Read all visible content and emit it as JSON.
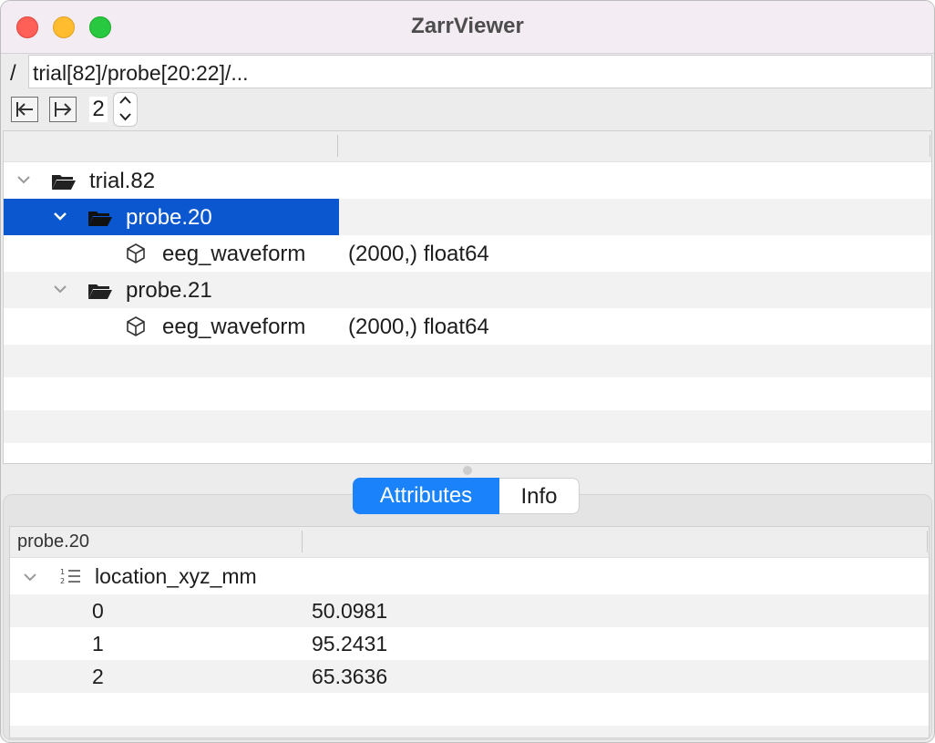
{
  "window": {
    "title": "ZarrViewer"
  },
  "path": {
    "root_sep": "/",
    "value": "trial[82]/probe[20:22]/..."
  },
  "toolbar": {
    "step_value": "2"
  },
  "tree": {
    "rows": [
      {
        "label": "trial.82",
        "info": "",
        "icon": "folder-open-icon",
        "expanded": true,
        "selected": false
      },
      {
        "label": "probe.20",
        "info": "",
        "icon": "folder-open-icon",
        "expanded": true,
        "selected": true
      },
      {
        "label": "eeg_waveform",
        "info": "(2000,) float64",
        "icon": "array-cube-icon"
      },
      {
        "label": "probe.21",
        "info": "",
        "icon": "folder-open-icon",
        "expanded": true,
        "selected": false
      },
      {
        "label": "eeg_waveform",
        "info": "(2000,) float64",
        "icon": "array-cube-icon"
      }
    ]
  },
  "tabs": {
    "attributes": "Attributes",
    "info": "Info",
    "active": "Attributes"
  },
  "attributes": {
    "header": "probe.20",
    "group": {
      "name": "location_xyz_mm",
      "icon": "numbered-list-icon"
    },
    "items": [
      {
        "index": "0",
        "value": "50.0981"
      },
      {
        "index": "1",
        "value": "95.2431"
      },
      {
        "index": "2",
        "value": "65.3636"
      }
    ]
  },
  "colors": {
    "selection": "#0b57d0",
    "segment_active": "#1a82fb"
  }
}
